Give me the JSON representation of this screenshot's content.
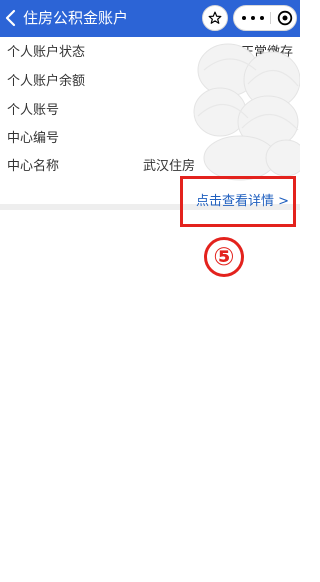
{
  "header": {
    "title": "住房公积金账户",
    "back_icon": "chevron-left-icon",
    "star_icon": "star-icon",
    "more_icon": "more-dots-icon",
    "close_icon": "target-circle-icon",
    "bg_color": "#2c64d6"
  },
  "account": {
    "rows": [
      {
        "label": "个人账户状态",
        "value": "正常缴存"
      },
      {
        "label": "个人账户余额",
        "value": ""
      },
      {
        "label": "个人账号",
        "value": ""
      },
      {
        "label": "中心编号",
        "value": ""
      },
      {
        "label": "中心名称",
        "value": "武汉住房"
      }
    ],
    "detail_link": "点击查看详情 >"
  },
  "annotation": {
    "step": "⑤",
    "color": "#e3221d"
  }
}
